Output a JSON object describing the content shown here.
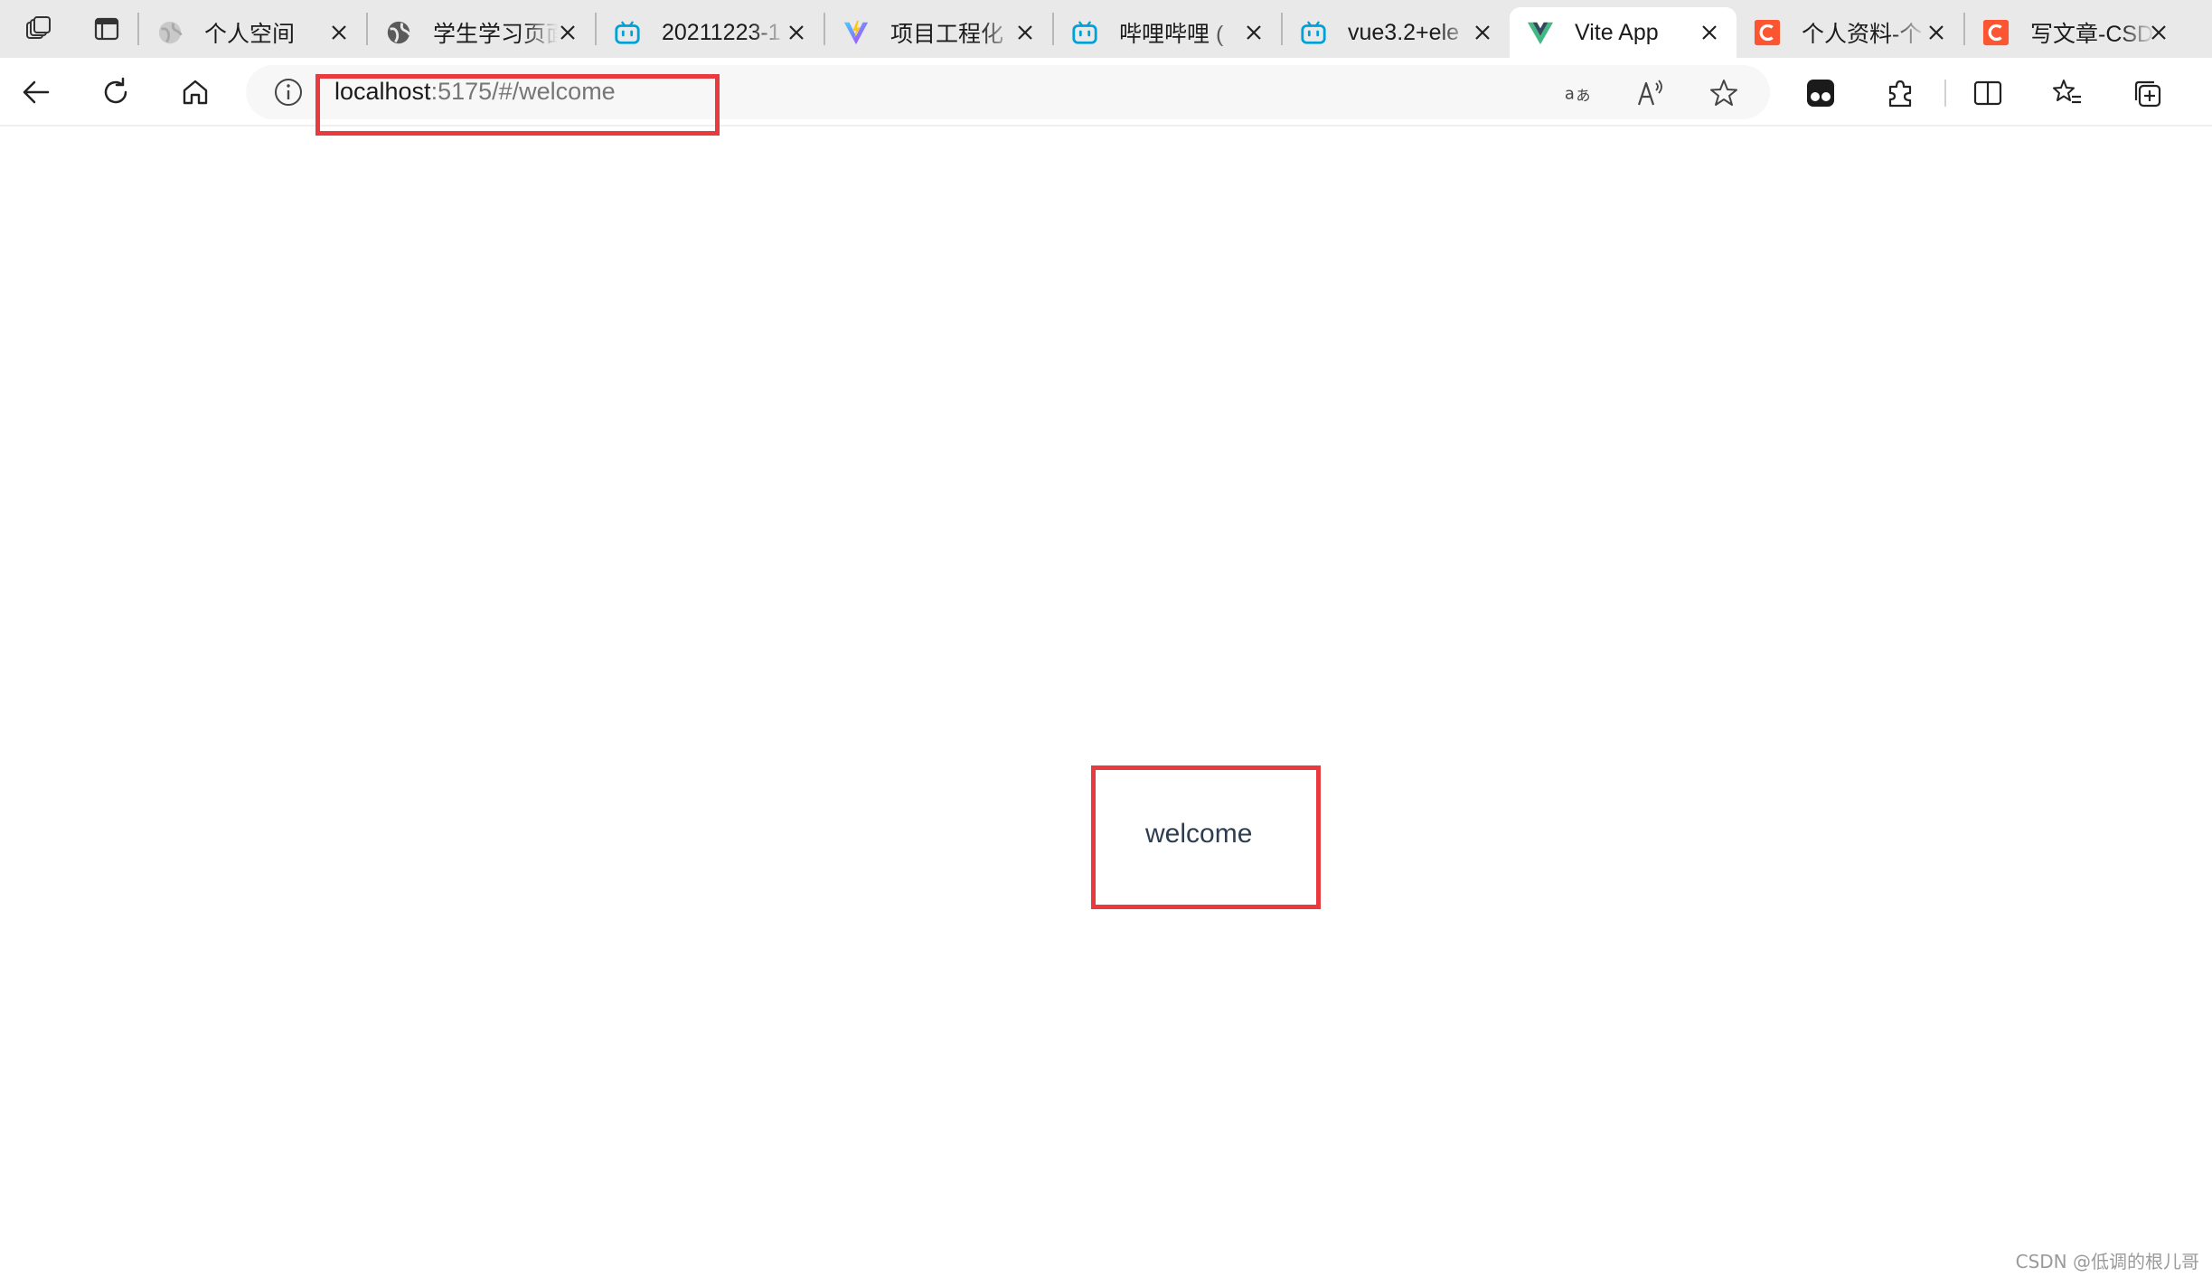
{
  "tabs": [
    {
      "title": "个人空间",
      "favicon": "globe-gray-icon",
      "active": false
    },
    {
      "title": "学生学习页面",
      "favicon": "globe-dark-icon",
      "active": false
    },
    {
      "title": "20211223-1",
      "favicon": "bilibili-icon",
      "active": false
    },
    {
      "title": "项目工程化",
      "favicon": "vite-icon",
      "active": false
    },
    {
      "title": "哔哩哔哩 (",
      "favicon": "bilibili-icon",
      "active": false
    },
    {
      "title": "vue3.2+ele",
      "favicon": "bilibili-icon",
      "active": false
    },
    {
      "title": "Vite App",
      "favicon": "vue-icon",
      "active": true
    },
    {
      "title": "个人资料-个",
      "favicon": "csdn-icon",
      "active": false
    },
    {
      "title": "写文章-CSD",
      "favicon": "csdn-icon",
      "active": false
    }
  ],
  "address": {
    "host": "localhost",
    "path": ":5175/#/welcome"
  },
  "page": {
    "content_text": "welcome"
  },
  "watermark": "CSDN @低调的根儿哥",
  "colors": {
    "highlight": "#e83a3f",
    "tabbar_bg": "#e9e9e9",
    "bilibili": "#00a1d6",
    "csdn": "#fc5531",
    "vue_green": "#42b883",
    "text": "#2c3e50"
  }
}
